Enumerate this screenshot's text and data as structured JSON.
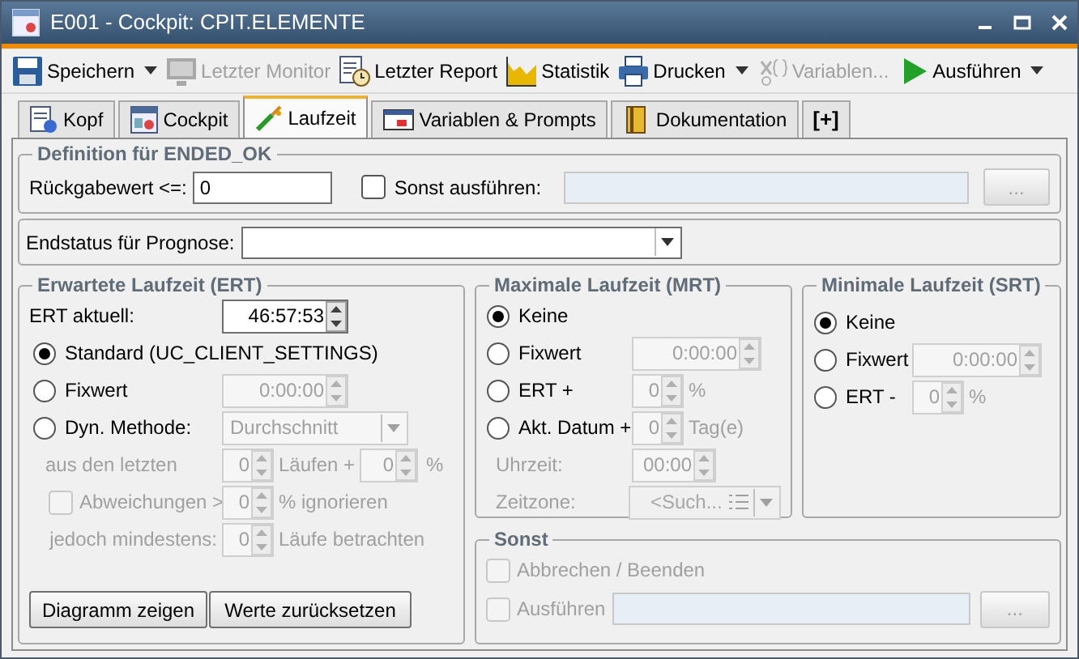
{
  "window": {
    "title": "E001 - Cockpit: CPIT.ELEMENTE"
  },
  "toolbar": [
    {
      "label": "Speichern",
      "disabled": false,
      "dropdown": true
    },
    {
      "label": "Letzter Monitor",
      "disabled": true,
      "dropdown": false
    },
    {
      "label": "Letzter Report",
      "disabled": false,
      "dropdown": false
    },
    {
      "label": "Statistik",
      "disabled": false,
      "dropdown": false
    },
    {
      "label": "Drucken",
      "disabled": false,
      "dropdown": true
    },
    {
      "label": "Variablen...",
      "disabled": true,
      "dropdown": false
    },
    {
      "label": "Ausführen",
      "disabled": false,
      "dropdown": true
    }
  ],
  "tabs": [
    {
      "label": "Kopf",
      "selected": false
    },
    {
      "label": "Cockpit",
      "selected": false
    },
    {
      "label": "Laufzeit",
      "selected": true
    },
    {
      "label": "Variablen & Prompts",
      "selected": false
    },
    {
      "label": "Dokumentation",
      "selected": false
    },
    {
      "label": "[+]",
      "selected": false
    }
  ],
  "definition": {
    "title": "Definition für ENDED_OK",
    "return_label": "Rückgabewert <=:",
    "return_value": "0",
    "else_label": "Sonst ausführen:",
    "else_checked": false,
    "browse": "..."
  },
  "prognosis": {
    "label": "Endstatus für Prognose:"
  },
  "ert": {
    "title": "Erwartete Laufzeit (ERT)",
    "current_label": "ERT aktuell:",
    "current_value": "46:57:53",
    "options": [
      {
        "label": "Standard (UC_CLIENT_SETTINGS)",
        "selected": true,
        "kind": "plain"
      },
      {
        "label": "Fixwert",
        "selected": false,
        "kind": "time",
        "value": "0:00:00",
        "disabled": true
      },
      {
        "label": "Dyn. Methode:",
        "selected": false,
        "kind": "select",
        "value": "Durchschnitt",
        "disabled": true
      }
    ],
    "last_runs": {
      "label": "aus den letzten",
      "runs": "0",
      "runs_unit": "Läufen +",
      "percent": "0",
      "percent_unit": "%",
      "disabled": true
    },
    "deviations": {
      "label": "Abweichungen >",
      "checked": false,
      "value": "0",
      "unit": "% ignorieren",
      "disabled": true
    },
    "minimum": {
      "label": "jedoch mindestens:",
      "value": "0",
      "unit": "Läufe betrachten",
      "disabled": true
    },
    "buttons": [
      "Diagramm zeigen",
      "Werte zurücksetzen"
    ]
  },
  "mrt": {
    "title": "Maximale Laufzeit (MRT)",
    "options": [
      {
        "label": "Keine",
        "selected": true,
        "kind": "plain"
      },
      {
        "label": "Fixwert",
        "selected": false,
        "kind": "time",
        "value": "0:00:00",
        "disabled": true
      },
      {
        "label": "ERT +",
        "selected": false,
        "kind": "number",
        "value": "0",
        "unit": "%",
        "disabled": true
      },
      {
        "label": "Akt. Datum +",
        "selected": false,
        "kind": "number",
        "value": "0",
        "unit": "Tag(e)",
        "disabled": true
      }
    ],
    "time_of_day": {
      "label": "Uhrzeit:",
      "value": "00:00",
      "disabled": true
    },
    "timezone": {
      "label": "Zeitzone:",
      "value": "<Such...",
      "disabled": true
    }
  },
  "srt": {
    "title": "Minimale Laufzeit (SRT)",
    "options": [
      {
        "label": "Keine",
        "selected": true,
        "kind": "plain"
      },
      {
        "label": "Fixwert",
        "selected": false,
        "kind": "time",
        "value": "0:00:00",
        "disabled": true
      },
      {
        "label": "ERT -",
        "selected": false,
        "kind": "number",
        "value": "0",
        "unit": "%",
        "disabled": true
      }
    ]
  },
  "otherwise": {
    "title": "Sonst",
    "abort_label": "Abbrechen / Beenden",
    "abort_checked": false,
    "run_label": "Ausführen",
    "run_checked": false,
    "disabled": true,
    "browse": "..."
  }
}
